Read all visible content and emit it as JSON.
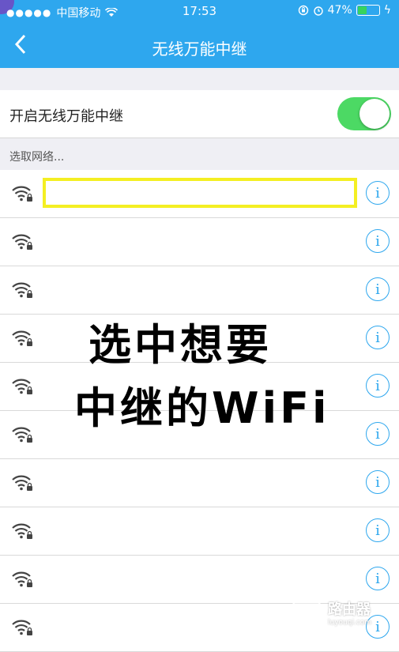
{
  "status_bar": {
    "carrier": "中国移动",
    "time": "17:53",
    "battery_percent": "47%",
    "battery_level": 0.47,
    "icons": [
      "signal-dots-icon",
      "wifi-icon",
      "orientation-lock-icon",
      "alarm-icon",
      "battery-icon",
      "charging-icon"
    ]
  },
  "header": {
    "title": "无线万能中继",
    "back_icon": "chevron-left-icon"
  },
  "toggle": {
    "label": "开启无线万能中继",
    "state": "on",
    "color": "#4cd964"
  },
  "network_section": {
    "header": "选取网络...",
    "rows": [
      {
        "name": "",
        "selected": true
      },
      {
        "name": ""
      },
      {
        "name": ""
      },
      {
        "name": ""
      },
      {
        "name": ""
      },
      {
        "name": ""
      },
      {
        "name": ""
      },
      {
        "name": ""
      },
      {
        "name": ""
      },
      {
        "name": ""
      }
    ],
    "info_glyph": "i"
  },
  "overlay": {
    "line1": "选中想要",
    "line2": "中继的WiFi"
  },
  "watermark": {
    "text": "路由器",
    "sub": "luyouqi.com"
  },
  "colors": {
    "accent": "#2ea7ee",
    "highlight": "#f4ef22"
  }
}
